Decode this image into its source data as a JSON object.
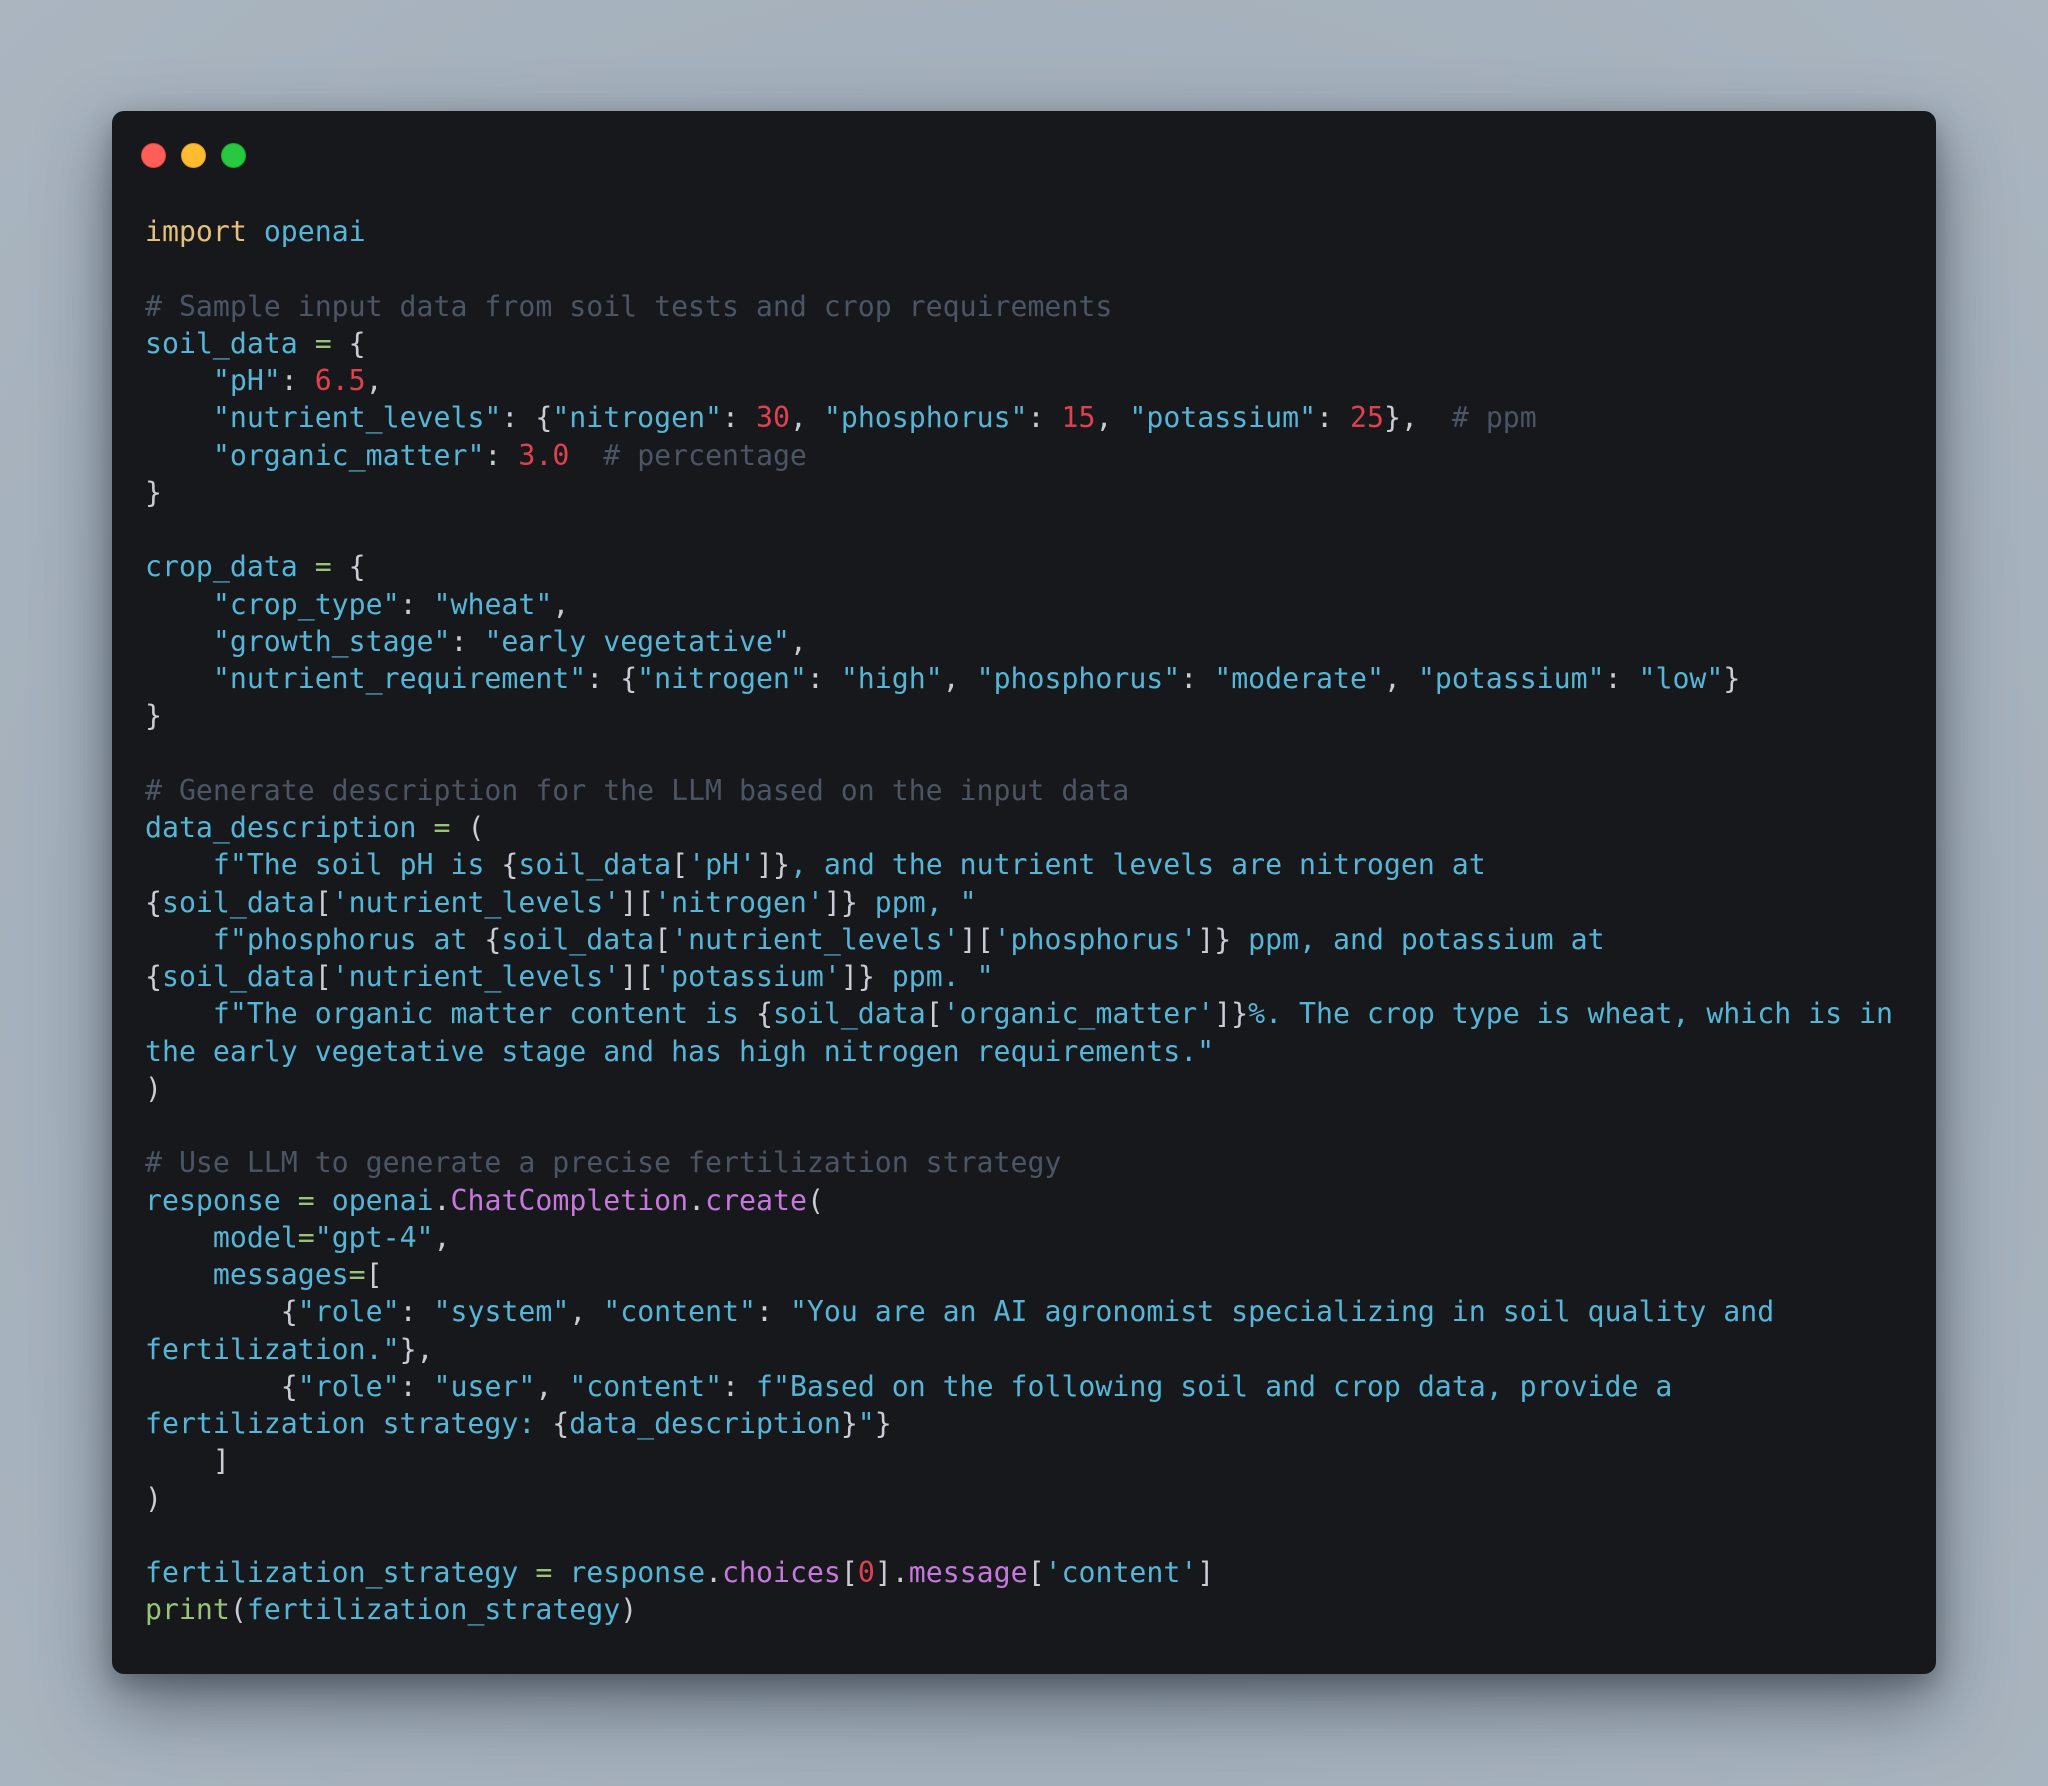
{
  "window": {
    "controls": [
      "close",
      "minimize",
      "maximize"
    ],
    "colors": {
      "background": "#17181b",
      "close": "#ff5f57",
      "minimize": "#febc2e",
      "maximize": "#28c840"
    }
  },
  "syntax_colors": {
    "keyword": "#e5c07b",
    "identifier": "#56b6d8",
    "string": "#56b6d8",
    "comment": "#4b5563",
    "number": "#e0414e",
    "operator": "#98c379",
    "attribute": "#c678dd",
    "punctuation": "#c8ccd4"
  },
  "code": {
    "language": "python",
    "lines": [
      [
        {
          "t": "kw",
          "v": "import"
        },
        {
          "t": "pn",
          "v": " "
        },
        {
          "t": "id",
          "v": "openai"
        }
      ],
      [],
      [
        {
          "t": "cm",
          "v": "# Sample input data from soil tests and crop requirements"
        }
      ],
      [
        {
          "t": "id",
          "v": "soil_data"
        },
        {
          "t": "pn",
          "v": " "
        },
        {
          "t": "op",
          "v": "="
        },
        {
          "t": "pn",
          "v": " {"
        }
      ],
      [
        {
          "t": "pn",
          "v": "    "
        },
        {
          "t": "str",
          "v": "\"pH\""
        },
        {
          "t": "pn",
          "v": ": "
        },
        {
          "t": "num",
          "v": "6.5"
        },
        {
          "t": "pn",
          "v": ","
        }
      ],
      [
        {
          "t": "pn",
          "v": "    "
        },
        {
          "t": "str",
          "v": "\"nutrient_levels\""
        },
        {
          "t": "pn",
          "v": ": {"
        },
        {
          "t": "str",
          "v": "\"nitrogen\""
        },
        {
          "t": "pn",
          "v": ": "
        },
        {
          "t": "num",
          "v": "30"
        },
        {
          "t": "pn",
          "v": ", "
        },
        {
          "t": "str",
          "v": "\"phosphorus\""
        },
        {
          "t": "pn",
          "v": ": "
        },
        {
          "t": "num",
          "v": "15"
        },
        {
          "t": "pn",
          "v": ", "
        },
        {
          "t": "str",
          "v": "\"potassium\""
        },
        {
          "t": "pn",
          "v": ": "
        },
        {
          "t": "num",
          "v": "25"
        },
        {
          "t": "pn",
          "v": "},  "
        },
        {
          "t": "cm",
          "v": "# ppm"
        }
      ],
      [
        {
          "t": "pn",
          "v": "    "
        },
        {
          "t": "str",
          "v": "\"organic_matter\""
        },
        {
          "t": "pn",
          "v": ": "
        },
        {
          "t": "num",
          "v": "3.0"
        },
        {
          "t": "pn",
          "v": "  "
        },
        {
          "t": "cm",
          "v": "# percentage"
        }
      ],
      [
        {
          "t": "pn",
          "v": "}"
        }
      ],
      [],
      [
        {
          "t": "id",
          "v": "crop_data"
        },
        {
          "t": "pn",
          "v": " "
        },
        {
          "t": "op",
          "v": "="
        },
        {
          "t": "pn",
          "v": " {"
        }
      ],
      [
        {
          "t": "pn",
          "v": "    "
        },
        {
          "t": "str",
          "v": "\"crop_type\""
        },
        {
          "t": "pn",
          "v": ": "
        },
        {
          "t": "str",
          "v": "\"wheat\""
        },
        {
          "t": "pn",
          "v": ","
        }
      ],
      [
        {
          "t": "pn",
          "v": "    "
        },
        {
          "t": "str",
          "v": "\"growth_stage\""
        },
        {
          "t": "pn",
          "v": ": "
        },
        {
          "t": "str",
          "v": "\"early vegetative\""
        },
        {
          "t": "pn",
          "v": ","
        }
      ],
      [
        {
          "t": "pn",
          "v": "    "
        },
        {
          "t": "str",
          "v": "\"nutrient_requirement\""
        },
        {
          "t": "pn",
          "v": ": {"
        },
        {
          "t": "str",
          "v": "\"nitrogen\""
        },
        {
          "t": "pn",
          "v": ": "
        },
        {
          "t": "str",
          "v": "\"high\""
        },
        {
          "t": "pn",
          "v": ", "
        },
        {
          "t": "str",
          "v": "\"phosphorus\""
        },
        {
          "t": "pn",
          "v": ": "
        },
        {
          "t": "str",
          "v": "\"moderate\""
        },
        {
          "t": "pn",
          "v": ", "
        },
        {
          "t": "str",
          "v": "\"potassium\""
        },
        {
          "t": "pn",
          "v": ": "
        },
        {
          "t": "str",
          "v": "\"low\""
        },
        {
          "t": "pn",
          "v": "}"
        }
      ],
      [
        {
          "t": "pn",
          "v": "}"
        }
      ],
      [],
      [
        {
          "t": "cm",
          "v": "# Generate description for the LLM based on the input data"
        }
      ],
      [
        {
          "t": "id",
          "v": "data_description"
        },
        {
          "t": "pn",
          "v": " "
        },
        {
          "t": "op",
          "v": "="
        },
        {
          "t": "pn",
          "v": " ("
        }
      ],
      [
        {
          "t": "pn",
          "v": "    "
        },
        {
          "t": "str",
          "v": "f\"The soil pH is "
        },
        {
          "t": "pn",
          "v": "{"
        },
        {
          "t": "id",
          "v": "soil_data"
        },
        {
          "t": "pn",
          "v": "["
        },
        {
          "t": "str",
          "v": "'pH'"
        },
        {
          "t": "pn",
          "v": "]}"
        },
        {
          "t": "str",
          "v": ", and the nutrient levels are nitrogen at "
        }
      ],
      [
        {
          "t": "pn",
          "v": "{"
        },
        {
          "t": "id",
          "v": "soil_data"
        },
        {
          "t": "pn",
          "v": "["
        },
        {
          "t": "str",
          "v": "'nutrient_levels'"
        },
        {
          "t": "pn",
          "v": "]["
        },
        {
          "t": "str",
          "v": "'nitrogen'"
        },
        {
          "t": "pn",
          "v": "]}"
        },
        {
          "t": "str",
          "v": " ppm, \""
        }
      ],
      [
        {
          "t": "pn",
          "v": "    "
        },
        {
          "t": "str",
          "v": "f\"phosphorus at "
        },
        {
          "t": "pn",
          "v": "{"
        },
        {
          "t": "id",
          "v": "soil_data"
        },
        {
          "t": "pn",
          "v": "["
        },
        {
          "t": "str",
          "v": "'nutrient_levels'"
        },
        {
          "t": "pn",
          "v": "]["
        },
        {
          "t": "str",
          "v": "'phosphorus'"
        },
        {
          "t": "pn",
          "v": "]}"
        },
        {
          "t": "str",
          "v": " ppm, and potassium at "
        }
      ],
      [
        {
          "t": "pn",
          "v": "{"
        },
        {
          "t": "id",
          "v": "soil_data"
        },
        {
          "t": "pn",
          "v": "["
        },
        {
          "t": "str",
          "v": "'nutrient_levels'"
        },
        {
          "t": "pn",
          "v": "]["
        },
        {
          "t": "str",
          "v": "'potassium'"
        },
        {
          "t": "pn",
          "v": "]}"
        },
        {
          "t": "str",
          "v": " ppm. \""
        }
      ],
      [
        {
          "t": "pn",
          "v": "    "
        },
        {
          "t": "str",
          "v": "f\"The organic matter content is "
        },
        {
          "t": "pn",
          "v": "{"
        },
        {
          "t": "id",
          "v": "soil_data"
        },
        {
          "t": "pn",
          "v": "["
        },
        {
          "t": "str",
          "v": "'organic_matter'"
        },
        {
          "t": "pn",
          "v": "]}"
        },
        {
          "t": "str",
          "v": "%. The crop type is wheat, which is in "
        }
      ],
      [
        {
          "t": "str",
          "v": "the early vegetative stage and has high nitrogen requirements.\""
        }
      ],
      [
        {
          "t": "pn",
          "v": ")"
        }
      ],
      [],
      [
        {
          "t": "cm",
          "v": "# Use LLM to generate a precise fertilization strategy"
        }
      ],
      [
        {
          "t": "id",
          "v": "response"
        },
        {
          "t": "pn",
          "v": " "
        },
        {
          "t": "op",
          "v": "="
        },
        {
          "t": "pn",
          "v": " "
        },
        {
          "t": "id",
          "v": "openai"
        },
        {
          "t": "pn",
          "v": "."
        },
        {
          "t": "fn",
          "v": "ChatCompletion"
        },
        {
          "t": "pn",
          "v": "."
        },
        {
          "t": "fn",
          "v": "create"
        },
        {
          "t": "pn",
          "v": "("
        }
      ],
      [
        {
          "t": "pn",
          "v": "    "
        },
        {
          "t": "id",
          "v": "model"
        },
        {
          "t": "op",
          "v": "="
        },
        {
          "t": "str",
          "v": "\"gpt-4\""
        },
        {
          "t": "pn",
          "v": ","
        }
      ],
      [
        {
          "t": "pn",
          "v": "    "
        },
        {
          "t": "id",
          "v": "messages"
        },
        {
          "t": "op",
          "v": "="
        },
        {
          "t": "pn",
          "v": "["
        }
      ],
      [
        {
          "t": "pn",
          "v": "        {"
        },
        {
          "t": "str",
          "v": "\"role\""
        },
        {
          "t": "pn",
          "v": ": "
        },
        {
          "t": "str",
          "v": "\"system\""
        },
        {
          "t": "pn",
          "v": ", "
        },
        {
          "t": "str",
          "v": "\"content\""
        },
        {
          "t": "pn",
          "v": ": "
        },
        {
          "t": "str",
          "v": "\"You are an AI agronomist specializing in soil quality and "
        }
      ],
      [
        {
          "t": "str",
          "v": "fertilization.\""
        },
        {
          "t": "pn",
          "v": "},"
        }
      ],
      [
        {
          "t": "pn",
          "v": "        {"
        },
        {
          "t": "str",
          "v": "\"role\""
        },
        {
          "t": "pn",
          "v": ": "
        },
        {
          "t": "str",
          "v": "\"user\""
        },
        {
          "t": "pn",
          "v": ", "
        },
        {
          "t": "str",
          "v": "\"content\""
        },
        {
          "t": "pn",
          "v": ": "
        },
        {
          "t": "str",
          "v": "f\"Based on the following soil and crop data, provide a "
        }
      ],
      [
        {
          "t": "str",
          "v": "fertilization strategy: "
        },
        {
          "t": "pn",
          "v": "{"
        },
        {
          "t": "id",
          "v": "data_description"
        },
        {
          "t": "pn",
          "v": "}"
        },
        {
          "t": "str",
          "v": "\""
        },
        {
          "t": "pn",
          "v": "}"
        }
      ],
      [
        {
          "t": "pn",
          "v": "    ]"
        }
      ],
      [
        {
          "t": "pn",
          "v": ")"
        }
      ],
      [],
      [
        {
          "t": "id",
          "v": "fertilization_strategy"
        },
        {
          "t": "pn",
          "v": " "
        },
        {
          "t": "op",
          "v": "="
        },
        {
          "t": "pn",
          "v": " "
        },
        {
          "t": "id",
          "v": "response"
        },
        {
          "t": "pn",
          "v": "."
        },
        {
          "t": "fn",
          "v": "choices"
        },
        {
          "t": "pn",
          "v": "["
        },
        {
          "t": "num",
          "v": "0"
        },
        {
          "t": "pn",
          "v": "]."
        },
        {
          "t": "fn",
          "v": "message"
        },
        {
          "t": "pn",
          "v": "["
        },
        {
          "t": "str",
          "v": "'content'"
        },
        {
          "t": "pn",
          "v": "]"
        }
      ],
      [
        {
          "t": "bi",
          "v": "print"
        },
        {
          "t": "pn",
          "v": "("
        },
        {
          "t": "id",
          "v": "fertilization_strategy"
        },
        {
          "t": "pn",
          "v": ")"
        }
      ]
    ]
  }
}
